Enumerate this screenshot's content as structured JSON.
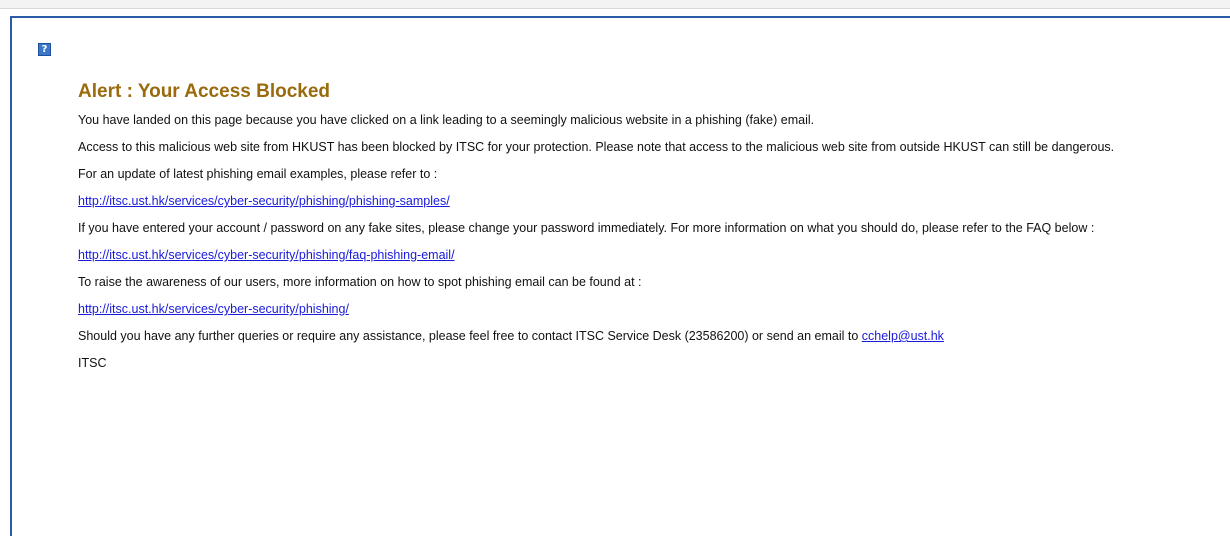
{
  "help_icon_glyph": "?",
  "colors": {
    "title": "#9a6a0c",
    "link": "#1a1adb",
    "frame_border": "#2a5aa8"
  },
  "alert": {
    "title": "Alert : Your Access Blocked",
    "p1": "You have landed on this page because you have clicked on a link leading to a seemingly malicious website in a phishing (fake) email.",
    "p2": "Access to this malicious web site from HKUST has been blocked by ITSC for your protection. Please note that access to the malicious web site from outside HKUST can still be dangerous.",
    "p3": "For an update of latest phishing email examples, please refer to :",
    "link1": "http://itsc.ust.hk/services/cyber-security/phishing/phishing-samples/",
    "p4": "If you have entered your account / password on any fake sites, please change your password immediately. For more information on what you should do, please refer to the FAQ below :",
    "link2": "http://itsc.ust.hk/services/cyber-security/phishing/faq-phishing-email/",
    "p5": "To raise the awareness of our users, more information on how to spot phishing email can be found at :",
    "link3": "http://itsc.ust.hk/services/cyber-security/phishing/",
    "p6_prefix": "Should you have any further queries or require any assistance, please feel free to contact ITSC Service Desk (23586200) or send an email to ",
    "email_link": "cchelp@ust.hk",
    "signature": "ITSC"
  }
}
